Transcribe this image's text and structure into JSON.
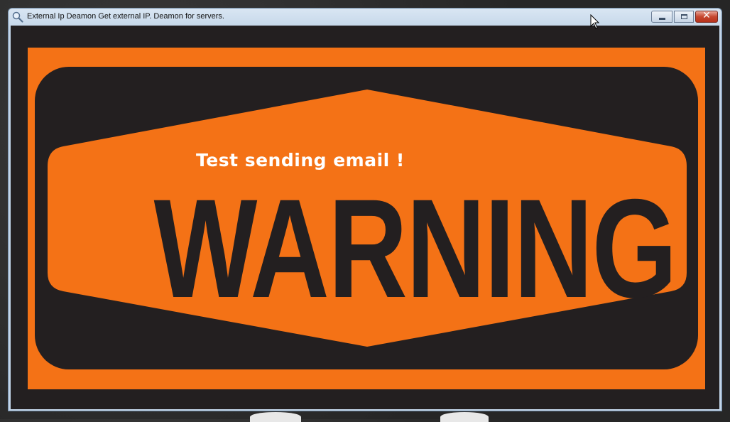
{
  "window": {
    "title": "External Ip Deamon Get external IP. Deamon for servers.",
    "icon": "magnifier-app-icon",
    "controls": [
      "minimize",
      "maximize",
      "close"
    ]
  },
  "sign": {
    "heading": "WARNING",
    "message": "Test sending email !",
    "colors": {
      "orange": "#f47216",
      "dark": "#231f20",
      "text": "#ffffff"
    }
  }
}
